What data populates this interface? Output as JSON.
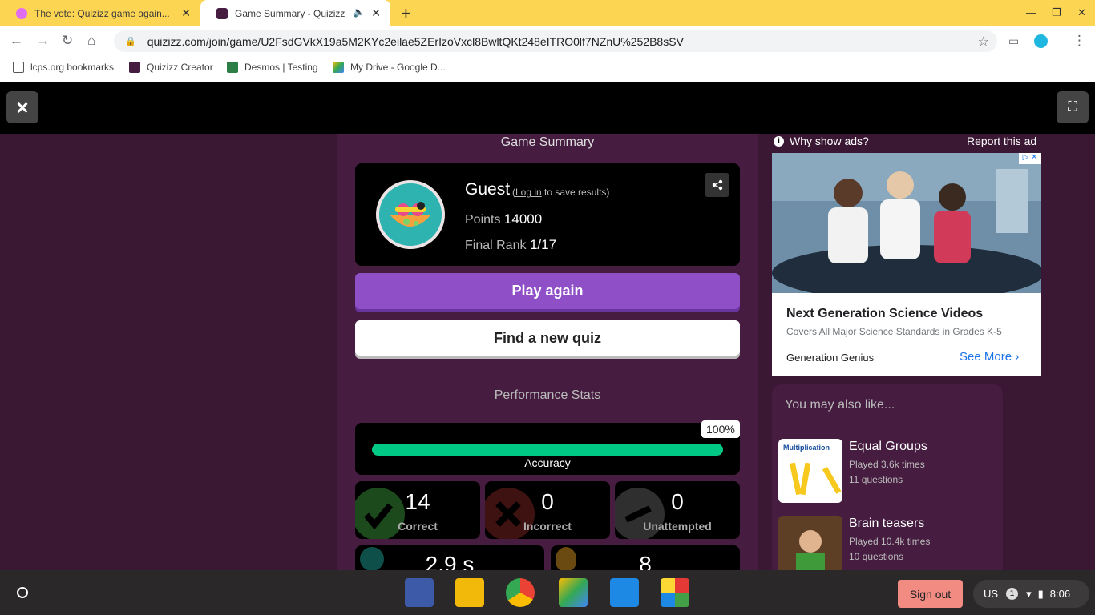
{
  "browser": {
    "tabs": [
      {
        "title": "The vote: Quizizz game again...",
        "favicon_color": "#e06df0"
      },
      {
        "title": "Game Summary - Quizizz",
        "favicon_color": "#461c40"
      }
    ],
    "url": "quizizz.com/join/game/U2FsdGVkX19a5M2KYc2eilae5ZErIzoVxcl8BwltQKt248eITRO0lf7NZnU%252B8sSV",
    "bookmarks": [
      "lcps.org bookmarks",
      "Quizizz Creator",
      "Desmos | Testing",
      "My Drive - Google D..."
    ]
  },
  "header": {
    "close_icon": "×",
    "fullscreen_icon": "⛶"
  },
  "summary": {
    "title": "Game Summary",
    "name": "Guest",
    "login_link": "Log in",
    "login_prefix": "(",
    "login_suffix": " to save results)",
    "points_label": "Points",
    "points_value": "14000",
    "rank_label": "Final Rank",
    "rank_value": "1/17",
    "play_again": "Play again",
    "find_quiz": "Find a new quiz"
  },
  "performance": {
    "title": "Performance Stats",
    "accuracy_label": "Accuracy",
    "accuracy_text": "100%",
    "accuracy_fraction": 1.0,
    "correct": "14",
    "correct_label": "Correct",
    "incorrect": "0",
    "incorrect_label": "Incorrect",
    "unattempted": "0",
    "unattempted_label": "Unattempted",
    "time_partial": "2.9 s",
    "streak_partial": "8"
  },
  "ad": {
    "why": "Why show ads?",
    "report": "Report this ad",
    "title": "Next Generation Science Videos",
    "subtitle": "Covers All Major Science Standards in Grades K-5",
    "brand": "Generation Genius",
    "cta": "See More"
  },
  "recommendations": {
    "title": "You may also like...",
    "items": [
      {
        "title": "Equal Groups",
        "played": "Played 3.6k times",
        "questions": "11 questions",
        "thumb_caption": "Multiplication"
      },
      {
        "title": "Brain teasers",
        "played": "Played 10.4k times",
        "questions": "10 questions"
      }
    ]
  },
  "shelf": {
    "sign_out": "Sign out",
    "locale": "US",
    "notifications": "1",
    "time": "8:06"
  }
}
